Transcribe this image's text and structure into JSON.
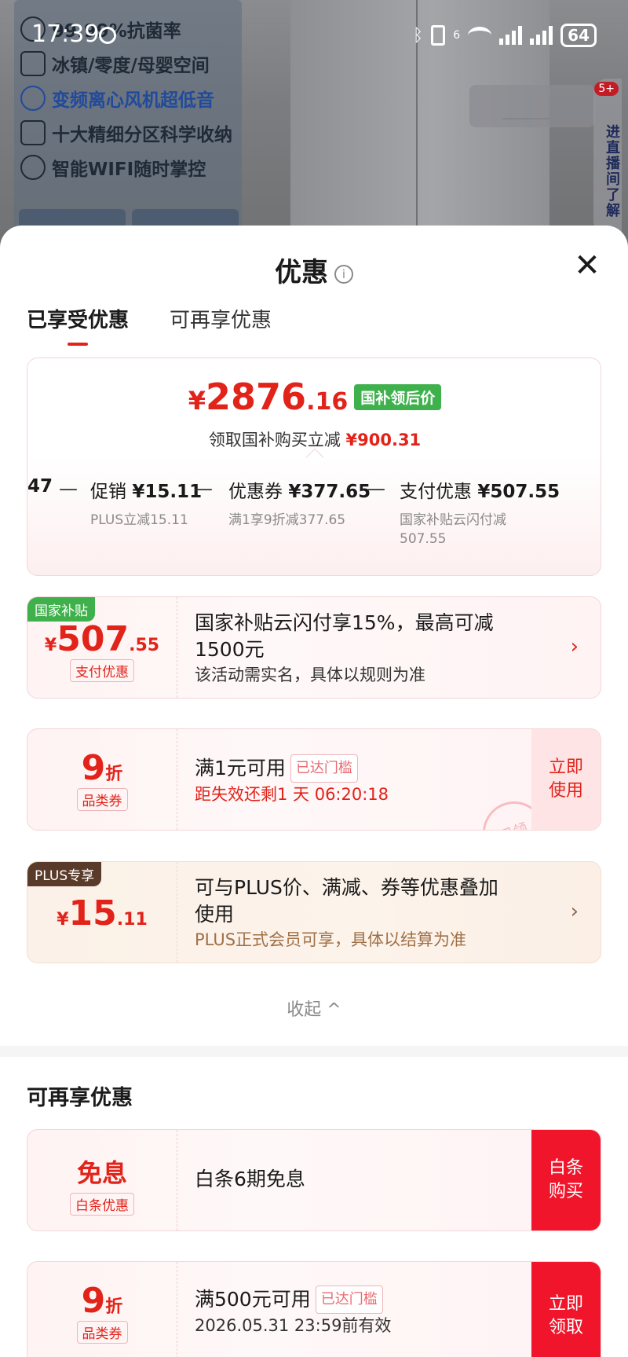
{
  "status_bar": {
    "time": "17:39",
    "bluetooth": "ᛒ",
    "network": "6",
    "battery": "64"
  },
  "background": {
    "features": [
      "99.99%抗菌率",
      "冰镇/零度/母婴空间",
      "变频离心风机超低音",
      "十大精细分区科学收纳",
      "智能WIFI随时掌控"
    ],
    "side_float_text": "进直播间了解",
    "side_badge": "5+"
  },
  "sheet": {
    "title": "优惠",
    "info_icon": "i",
    "close_icon": "✕",
    "tabs": [
      {
        "label": "已享受优惠",
        "active": true
      },
      {
        "label": "可再享优惠",
        "active": false
      }
    ]
  },
  "summary": {
    "price_yen": "¥",
    "price_int": "2876",
    "price_dec": ".16",
    "price_tag": "国补领后价",
    "subtitle_prefix": "领取国补购买立减",
    "subtitle_amount": "¥900.31",
    "breakdown": [
      {
        "label": "47",
        "amount": "",
        "note": ""
      },
      {
        "label": "促销",
        "amount": "¥15.11",
        "note": "PLUS立减15.11"
      },
      {
        "label": "优惠券",
        "amount": "¥377.65",
        "note": "满1享9折减377.65"
      },
      {
        "label": "支付优惠",
        "amount": "¥507.55",
        "note_line1": "国家补贴云闪付减",
        "note_line2": "507.55"
      }
    ],
    "minus": "—"
  },
  "coupons_applied": [
    {
      "corner": "国家补贴",
      "yen": "¥",
      "int": "507",
      "dec": ".55",
      "tag": "支付优惠",
      "title_line1": "国家补贴云闪付享15%，最高可减",
      "title_line2": "1500元",
      "desc": "该活动需实名，具体以规则为准",
      "chevron": "›"
    },
    {
      "int": "9",
      "unit": "折",
      "tag": "品类券",
      "title": "满1元可用",
      "gate": "已达门槛",
      "countdown": "距失效还剩1 天 06:20:18",
      "button_line1": "立即",
      "button_line2": "使用",
      "stamp": "已领"
    },
    {
      "corner": "PLUS专享",
      "yen": "¥",
      "int": "15",
      "dec": ".11",
      "title_line1": "可与PLUS价、满减、券等优惠叠加",
      "title_line2": "使用",
      "desc": "PLUS正式会员可享，具体以结算为准",
      "chevron": "›"
    }
  ],
  "collapse_label": "收起 ^",
  "more_section": {
    "title": "可再享优惠",
    "items": [
      {
        "main": "免息",
        "tag": "白条优惠",
        "title": "白条6期免息",
        "button_line1": "白条",
        "button_line2": "购买"
      },
      {
        "int": "9",
        "unit": "折",
        "tag": "品类券",
        "title": "满500元可用",
        "gate": "已达门槛",
        "expiry": "2026.05.31 23:59前有效",
        "button_line1": "立即",
        "button_line2": "领取"
      }
    ]
  },
  "colors": {
    "accent_red": "#e2231a",
    "green_tag": "#3fb14c",
    "plus_brown": "#5a3b2a",
    "button_red": "#f0152b"
  }
}
